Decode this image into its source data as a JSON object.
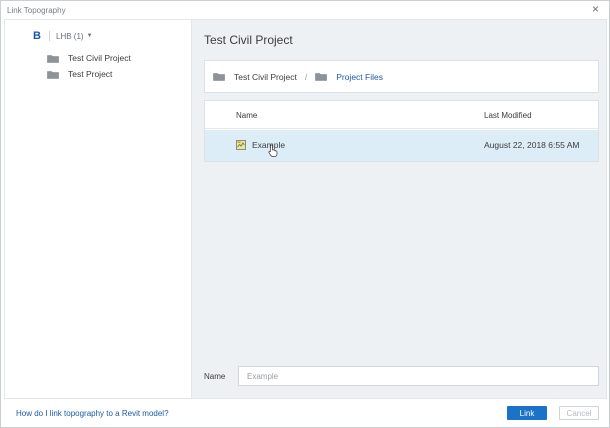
{
  "window": {
    "title": "Link Topography",
    "close_glyph": "×"
  },
  "hub": {
    "logo": "B",
    "name": "LHB (1)",
    "caret": "▼"
  },
  "projects": [
    {
      "label": "Test Civil Project",
      "active": true
    },
    {
      "label": "Test Project",
      "active": false
    }
  ],
  "main": {
    "title": "Test Civil Project",
    "breadcrumb": [
      {
        "label": "Test Civil Project"
      },
      {
        "label": "Project Files",
        "active": true
      }
    ],
    "breadcrumb_separator": "/",
    "table": {
      "columns": [
        "Name",
        "Last Modified"
      ],
      "rows": [
        {
          "name": "Example",
          "modified": "August 22, 2018 6:55 AM",
          "selected": true
        }
      ]
    },
    "name_field": {
      "label": "Name",
      "placeholder": "Example",
      "value": ""
    }
  },
  "footer": {
    "help_link": "How do I link topography to a Revit model?",
    "link_button": "Link",
    "cancel_button": "Cancel"
  },
  "colors": {
    "accent": "#1a73c9",
    "link_text": "#1a5aa6",
    "selected_row": "#dcedf7",
    "panel_bg": "#eef1f4"
  },
  "icons": {
    "folder": "folder-icon",
    "file": "topography-file-icon",
    "close": "close-icon",
    "cursor": "hand-cursor-icon"
  }
}
